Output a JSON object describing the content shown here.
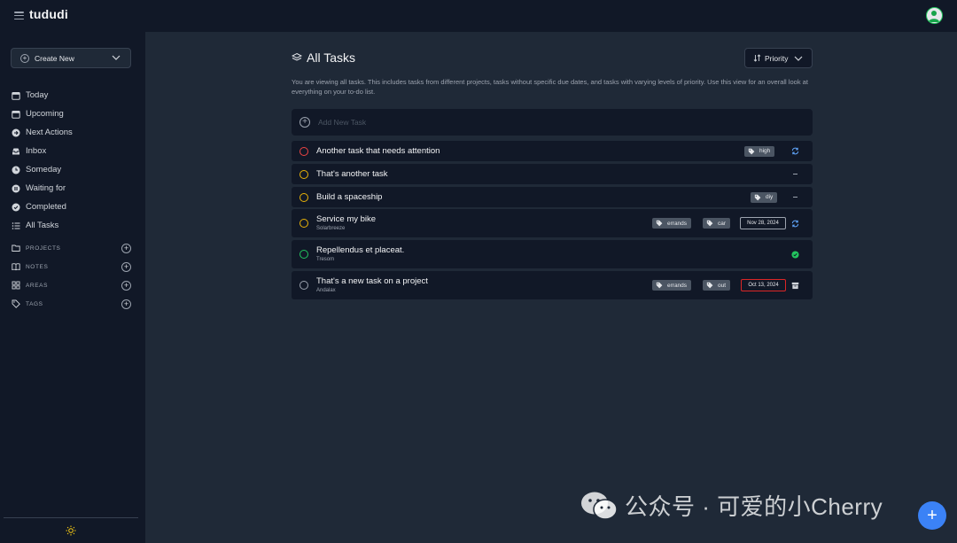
{
  "app": {
    "brand": "tududi"
  },
  "sidebar": {
    "create_label": "Create New",
    "items": [
      {
        "label": "Today",
        "icon": "calendar-icon"
      },
      {
        "label": "Upcoming",
        "icon": "calendar-icon"
      },
      {
        "label": "Next Actions",
        "icon": "arrow-right-circle-icon"
      },
      {
        "label": "Inbox",
        "icon": "inbox-icon"
      },
      {
        "label": "Someday",
        "icon": "clock-icon"
      },
      {
        "label": "Waiting for",
        "icon": "pause-circle-icon"
      },
      {
        "label": "Completed",
        "icon": "check-circle-icon"
      },
      {
        "label": "All Tasks",
        "icon": "list-icon"
      }
    ],
    "sections": [
      {
        "label": "PROJECTS",
        "icon": "folder-icon"
      },
      {
        "label": "NOTES",
        "icon": "book-icon"
      },
      {
        "label": "AREAS",
        "icon": "grid-icon"
      },
      {
        "label": "TAGS",
        "icon": "tag-icon"
      }
    ]
  },
  "main": {
    "title": "All Tasks",
    "sort_label": "Priority",
    "description": "You are viewing all tasks. This includes tasks from different projects, tasks without specific due dates, and tasks with varying levels of priority. Use this view for an overall look at everything on your to-do list.",
    "add_task_placeholder": "Add New Task",
    "tasks": [
      {
        "name": "Another task that needs attention",
        "project": "",
        "tags": [
          "high"
        ],
        "date": "",
        "status_icon": "repeat-icon",
        "circle_color": "#ef4444"
      },
      {
        "name": "That's another task",
        "project": "",
        "tags": [],
        "date": "",
        "status_icon": "dash-icon",
        "circle_color": "#eab308"
      },
      {
        "name": "Build a spaceship",
        "project": "",
        "tags": [
          "diy"
        ],
        "date": "",
        "status_icon": "dash-icon",
        "circle_color": "#eab308"
      },
      {
        "name": "Service my bike",
        "project": "Solarbreeze",
        "tags": [
          "errands",
          "car"
        ],
        "date": "Nov 28, 2024",
        "status_icon": "repeat-icon",
        "circle_color": "#eab308"
      },
      {
        "name": "Repellendus et placeat.",
        "project": "Tresom",
        "tags": [],
        "date": "",
        "status_icon": "check-circle-icon",
        "circle_color": "#22c55e"
      },
      {
        "name": "That's a new task on a project",
        "project": "Andalax",
        "tags": [
          "errands",
          "out"
        ],
        "date": "Oct 13, 2024",
        "status_icon": "archive-icon",
        "circle_color": "#9ca3af"
      }
    ]
  },
  "watermark": "公众号 · 可爱的小Cherry",
  "colors": {
    "accent": "#3b82f6",
    "sidebar_bg": "#111827",
    "main_bg": "#1f2937"
  }
}
